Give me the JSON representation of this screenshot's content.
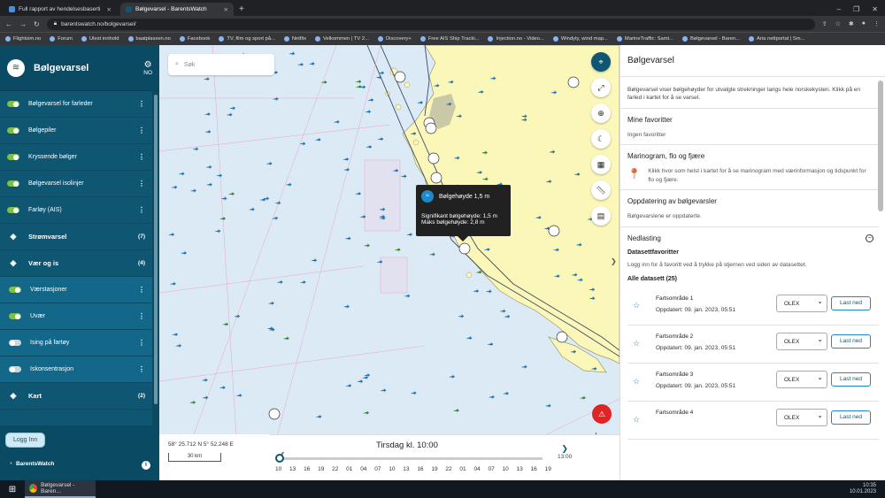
{
  "browser": {
    "tabs": [
      {
        "title": "Full rapport av hendelsesbaserti",
        "active": false
      },
      {
        "title": "Bølgevarsel - BarentsWatch",
        "active": true
      }
    ],
    "new_tab": "+",
    "window_controls": [
      "–",
      "❐",
      "✕"
    ],
    "url": "barentswatch.no/bolgevarsel/",
    "bookmarks": [
      "Flightsim.no",
      "Forum",
      "Ulest innhold",
      "baatplassen.no",
      "Facebook",
      "TV, film og sport på...",
      "Netflix",
      "Velkommen | TV 2...",
      "Discovery+",
      "Free AIS Ship Tracki...",
      "Injection.no - Video...",
      "Windyty, wind map...",
      "MarineTraffic: Samt...",
      "Bølgevarsel - Baren...",
      "Aria nettportal | Sm..."
    ]
  },
  "sidebar": {
    "title": "Bølgevarsel",
    "language": "NO",
    "items": [
      {
        "label": "Bølgevarsel for farleder",
        "type": "toggle",
        "state": "on"
      },
      {
        "label": "Bølgepiler",
        "type": "toggle",
        "state": "on"
      },
      {
        "label": "Kryssende bølger",
        "type": "toggle",
        "state": "on"
      },
      {
        "label": "Bølgevarsel isolinjer",
        "type": "toggle",
        "state": "on"
      },
      {
        "label": "Farløy (AIS)",
        "type": "toggle",
        "state": "on"
      },
      {
        "label": "Strømvarsel",
        "type": "section",
        "count": "(7)"
      },
      {
        "label": "Vær og is",
        "type": "section",
        "count": "(4)"
      },
      {
        "label": "Værstasjoner",
        "type": "subtoggle",
        "state": "on"
      },
      {
        "label": "Uvær",
        "type": "subtoggle",
        "state": "on"
      },
      {
        "label": "Ising på fartøy",
        "type": "subtoggle",
        "state": "off"
      },
      {
        "label": "Iskonsentrasjon",
        "type": "subtoggle",
        "state": "off"
      },
      {
        "label": "Kart",
        "type": "section",
        "count": "(2)"
      }
    ],
    "login_label": "Logg Inn",
    "brand": "BarentsWatch"
  },
  "map": {
    "search_placeholder": "Søk",
    "tooltip": {
      "title": "Bølgehøyde 1,5 m",
      "line1": "Signifikant bølgehøyde: 1,5 m",
      "line2": "Maks bølgehøyde: 2,8 m"
    },
    "coords": "58° 25.712 N 5° 52.248 E",
    "scale": "30 km",
    "timeline": {
      "title": "Tirsdag kl. 10:00",
      "next_time": "13:00",
      "ticks": [
        "10",
        "13",
        "16",
        "19",
        "22",
        "01",
        "04",
        "07",
        "10",
        "13",
        "16",
        "19",
        "22",
        "01",
        "04",
        "07",
        "10",
        "13",
        "16",
        "19"
      ]
    },
    "colors": {
      "land": "#fbf7b8",
      "sea": "#dceaf5",
      "accent": "#0e5672"
    }
  },
  "panel": {
    "title": "Bølgevarsel",
    "intro": "Bølgevarsel viser bølgehøyder for utvalgte strekninger langs hele norskekysten. Klikk på en farled i kartet for å se varsel.",
    "favorites_title": "Mine favoritter",
    "favorites_empty": "Ingen favoritter",
    "marinogram_title": "Marinogram, flo og fjære",
    "marinogram_text": "Klikk hvor som helst i kartet for å se marinogram med værinformasjon og tidspunkt for flo og fjære.",
    "update_title": "Oppdatering av bølgevarsler",
    "update_text": "Bølgevarslene er oppdaterte.",
    "download_title": "Nedlasting",
    "dataset_fav_title": "Datasettfavoritter",
    "dataset_fav_text": "Logg inn for å favoritt ved å trykke på stjernen ved siden av datasettet.",
    "all_datasets": "Alle datasett (25)",
    "datasets": [
      {
        "name": "Fartsområde 1",
        "updated": "Oppdatert: 09. jan. 2023, 05:51",
        "format": "OLEX",
        "button": "Last ned"
      },
      {
        "name": "Fartsområde 2",
        "updated": "Oppdatert: 09. jan. 2023, 05:51",
        "format": "OLEX",
        "button": "Last ned"
      },
      {
        "name": "Fartsområde 3",
        "updated": "Oppdatert: 09. jan. 2023, 05:51",
        "format": "OLEX",
        "button": "Last ned"
      },
      {
        "name": "Fartsområde 4",
        "updated": "",
        "format": "OLEX",
        "button": "Last ned"
      }
    ]
  },
  "taskbar": {
    "app": "Bølgevarsel - Baren...",
    "time": "10:35",
    "date": "10.01.2023"
  }
}
